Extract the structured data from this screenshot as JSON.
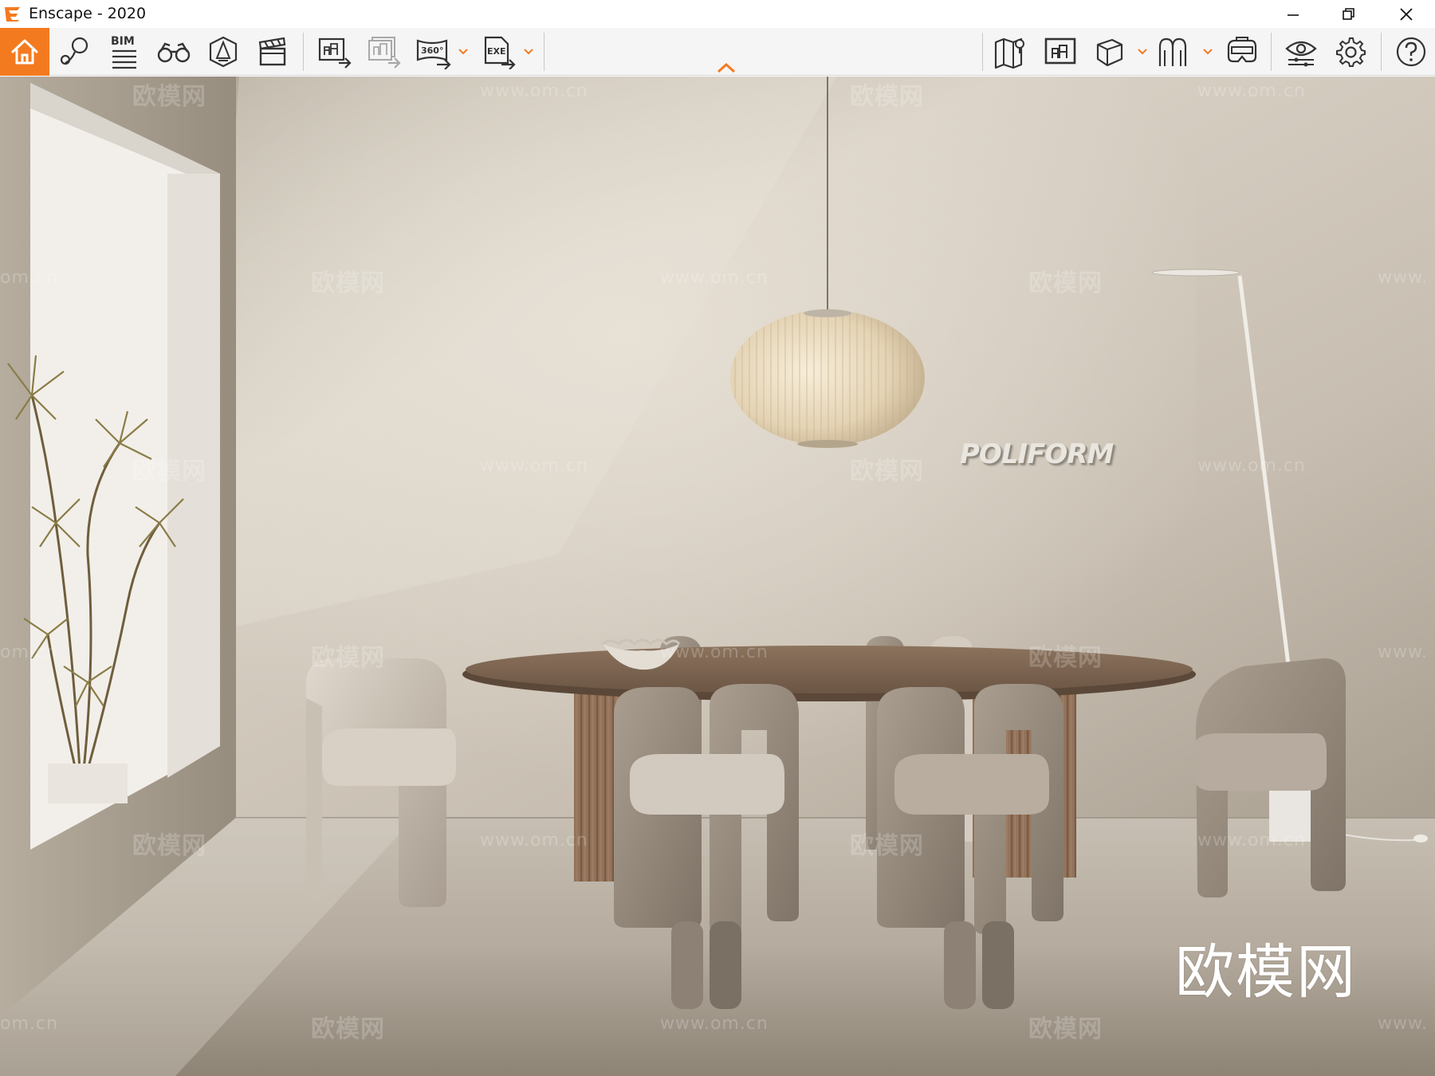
{
  "window": {
    "title": "Enscape - 2020",
    "accent_color": "#f47a20"
  },
  "toolbar": {
    "left_tools": [
      {
        "name": "home",
        "icon": "home-icon"
      },
      {
        "name": "views",
        "icon": "map-pin-icon"
      },
      {
        "name": "bim",
        "icon": "bim-icon",
        "label": "BIM"
      },
      {
        "name": "walk-mode",
        "icon": "binoculars-icon"
      },
      {
        "name": "assets",
        "icon": "bell-pyramid-icon"
      },
      {
        "name": "video-editor",
        "icon": "clapperboard-icon"
      },
      {
        "name": "render-image",
        "icon": "render-image-icon"
      },
      {
        "name": "batch-render",
        "icon": "batch-render-icon"
      },
      {
        "name": "export-360",
        "icon": "panorama-360-icon",
        "label": "360°"
      },
      {
        "name": "export-exe",
        "icon": "exe-export-icon",
        "label": "EXE"
      }
    ],
    "right_tools": [
      {
        "name": "map-view",
        "icon": "map-icon"
      },
      {
        "name": "screenshot-view",
        "icon": "render-view-icon"
      },
      {
        "name": "orthographic",
        "icon": "cube-icon"
      },
      {
        "name": "vr-headset-settings",
        "icon": "binaural-icon"
      },
      {
        "name": "vr-headset",
        "icon": "vr-headset-icon"
      },
      {
        "name": "visual-settings",
        "icon": "eye-settings-icon"
      },
      {
        "name": "settings",
        "icon": "gear-icon"
      },
      {
        "name": "help",
        "icon": "help-icon"
      }
    ]
  },
  "viewport": {
    "wall_logo": "POLIFORM",
    "brand_watermark": "欧模网",
    "watermark_cn": "欧模网",
    "watermark_url": "www.om.cn",
    "watermark_url_partial_left": "om.cn",
    "watermark_url_partial_right": "www."
  }
}
